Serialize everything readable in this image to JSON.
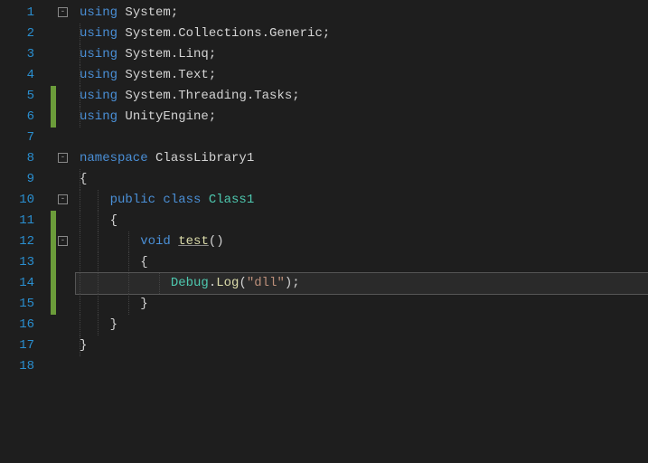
{
  "editor": {
    "lines": [
      {
        "num": 1,
        "fold": "-",
        "tokens": [
          {
            "t": "using ",
            "c": "kw"
          },
          {
            "t": "System",
            "c": "ns"
          },
          {
            "t": ";",
            "c": "punct"
          }
        ]
      },
      {
        "num": 2,
        "indent": 1,
        "tokens": [
          {
            "t": "using ",
            "c": "kw"
          },
          {
            "t": "System.Collections.Generic",
            "c": "ns"
          },
          {
            "t": ";",
            "c": "punct"
          }
        ]
      },
      {
        "num": 3,
        "indent": 1,
        "tokens": [
          {
            "t": "using ",
            "c": "kw"
          },
          {
            "t": "System.Linq",
            "c": "ns"
          },
          {
            "t": ";",
            "c": "punct"
          }
        ]
      },
      {
        "num": 4,
        "indent": 1,
        "tokens": [
          {
            "t": "using ",
            "c": "kw"
          },
          {
            "t": "System.Text",
            "c": "ns"
          },
          {
            "t": ";",
            "c": "punct"
          }
        ]
      },
      {
        "num": 5,
        "change": true,
        "indent": 1,
        "tokens": [
          {
            "t": "using ",
            "c": "kw"
          },
          {
            "t": "System.Threading.Tasks",
            "c": "ns"
          },
          {
            "t": ";",
            "c": "punct"
          }
        ]
      },
      {
        "num": 6,
        "change": true,
        "indent": 1,
        "tokens": [
          {
            "t": "using ",
            "c": "kw"
          },
          {
            "t": "UnityEngine",
            "c": "ns"
          },
          {
            "t": ";",
            "c": "punct"
          }
        ]
      },
      {
        "num": 7,
        "tokens": []
      },
      {
        "num": 8,
        "fold": "-",
        "tokens": [
          {
            "t": "namespace ",
            "c": "kw"
          },
          {
            "t": "ClassLibrary1",
            "c": "ns"
          }
        ]
      },
      {
        "num": 9,
        "indent": 1,
        "tokens": [
          {
            "t": "{",
            "c": "punct"
          }
        ]
      },
      {
        "num": 10,
        "fold": "-",
        "indent": 1,
        "guides": [
          1
        ],
        "tokens": [
          {
            "t": "    ",
            "c": ""
          },
          {
            "t": "public class ",
            "c": "kw"
          },
          {
            "t": "Class1",
            "c": "type"
          }
        ]
      },
      {
        "num": 11,
        "change": true,
        "indent": 1,
        "guides": [
          1
        ],
        "tokens": [
          {
            "t": "    {",
            "c": "punct"
          }
        ]
      },
      {
        "num": 12,
        "change": true,
        "fold": "-",
        "indent": 1,
        "guides": [
          1,
          2
        ],
        "tokens": [
          {
            "t": "        ",
            "c": ""
          },
          {
            "t": "void ",
            "c": "kw"
          },
          {
            "t": "test",
            "c": "method underline"
          },
          {
            "t": "()",
            "c": "punct"
          }
        ]
      },
      {
        "num": 13,
        "change": true,
        "indent": 1,
        "guides": [
          1,
          2
        ],
        "tokens": [
          {
            "t": "        {",
            "c": "punct"
          }
        ]
      },
      {
        "num": 14,
        "change": true,
        "current": true,
        "indent": 1,
        "guides": [
          1,
          2,
          3
        ],
        "tokens": [
          {
            "t": "            ",
            "c": ""
          },
          {
            "t": "Debug",
            "c": "type"
          },
          {
            "t": ".",
            "c": "punct"
          },
          {
            "t": "Log",
            "c": "method"
          },
          {
            "t": "(",
            "c": "punct"
          },
          {
            "t": "\"dll\"",
            "c": "str"
          },
          {
            "t": ")",
            "c": "punct"
          },
          {
            "t": ";",
            "c": "punct"
          }
        ]
      },
      {
        "num": 15,
        "change": true,
        "indent": 1,
        "guides": [
          1,
          2
        ],
        "tokens": [
          {
            "t": "        }",
            "c": "punct"
          }
        ]
      },
      {
        "num": 16,
        "indent": 1,
        "guides": [
          1
        ],
        "tokens": [
          {
            "t": "    }",
            "c": "punct"
          }
        ]
      },
      {
        "num": 17,
        "indent": 1,
        "tokens": [
          {
            "t": "}",
            "c": "punct"
          }
        ]
      },
      {
        "num": 18,
        "tokens": []
      }
    ]
  }
}
